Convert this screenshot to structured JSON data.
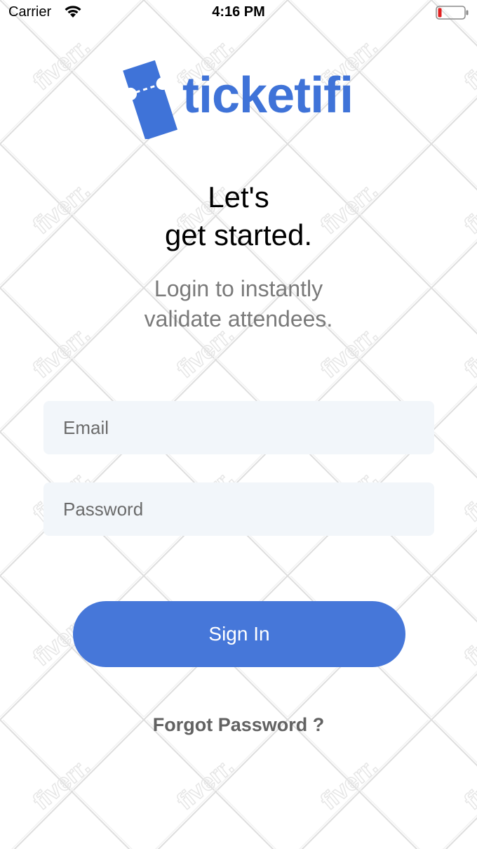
{
  "status_bar": {
    "carrier": "Carrier",
    "time": "4:16 PM",
    "wifi_icon": "wifi-icon",
    "battery_icon": "battery-low-icon",
    "battery_color": "#e02020"
  },
  "logo": {
    "text": "ticketifi",
    "icon": "ticket-icon",
    "color": "#3f73d8"
  },
  "headline": {
    "line1": "Let's",
    "line2": "get started."
  },
  "subtitle": {
    "line1": "Login to instantly",
    "line2": "validate attendees."
  },
  "form": {
    "email_placeholder": "Email",
    "password_placeholder": "Password",
    "field_background": "#f2f6fa"
  },
  "signin_button": {
    "label": "Sign In",
    "color": "#4677d9"
  },
  "forgot_password": {
    "label": "Forgot Password ?"
  },
  "watermark": {
    "text": "fiverr."
  }
}
